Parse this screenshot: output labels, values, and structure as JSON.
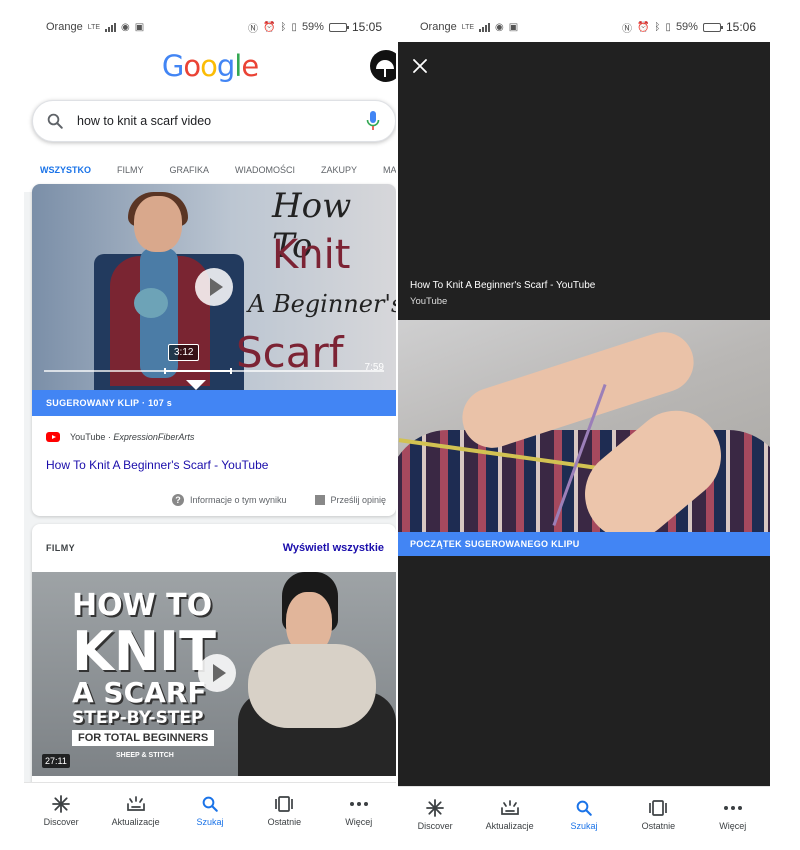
{
  "left": {
    "status_bar": {
      "carrier": "Orange",
      "network": "LTE",
      "battery": "59%",
      "time": "15:05"
    },
    "logo": "Google",
    "search": {
      "query": "how to knit a scarf video"
    },
    "tabs": [
      {
        "label": "WSZYSTKO",
        "active": true
      },
      {
        "label": "FILMY",
        "active": false
      },
      {
        "label": "GRAFIKA",
        "active": false
      },
      {
        "label": "WIADOMOŚCI",
        "active": false
      },
      {
        "label": "ZAKUPY",
        "active": false
      },
      {
        "label": "MA",
        "active": false
      }
    ],
    "featured": {
      "thumbnail_title": [
        "How To",
        "Knit",
        "A Beginner's",
        "Scarf"
      ],
      "clip_marker": "3:12",
      "duration": "7:59",
      "clip_label": "SUGEROWANY KLIP · 107 s",
      "source": "YouTube",
      "author": "ExpressionFiberArts",
      "title": "How To Knit A Beginner's Scarf - YouTube",
      "about_label": "Informacje o tym wyniku",
      "feedback_label": "Prześlij opinię"
    },
    "videos": {
      "header": "FILMY",
      "see_all": "Wyświetl wszystkie",
      "thumbnail_title": [
        "HOW TO",
        "KNIT",
        "A SCARF",
        "STEP-BY-STEP",
        "FOR TOTAL BEGINNERS"
      ],
      "thumbnail_brand": "SHEEP & STITCH",
      "duration": "27:11"
    }
  },
  "right": {
    "status_bar": {
      "carrier": "Orange",
      "network": "LTE",
      "battery": "59%",
      "time": "15:06"
    },
    "video_title": "How To Knit A Beginner's Scarf - YouTube",
    "video_source": "YouTube",
    "clip_start_label": "POCZĄTEK SUGEROWANEGO KLIPU"
  },
  "nav": [
    {
      "label": "Discover",
      "icon": "discover-icon",
      "active": false
    },
    {
      "label": "Aktualizacje",
      "icon": "updates-icon",
      "active": false
    },
    {
      "label": "Szukaj",
      "icon": "search-icon",
      "active": true
    },
    {
      "label": "Ostatnie",
      "icon": "recent-icon",
      "active": false
    },
    {
      "label": "Więcej",
      "icon": "more-icon",
      "active": false
    }
  ],
  "colors": {
    "google_blue": "#4285F4",
    "link": "#1a0dab",
    "accent": "#1a73e8",
    "youtube_red": "#FF0000"
  }
}
